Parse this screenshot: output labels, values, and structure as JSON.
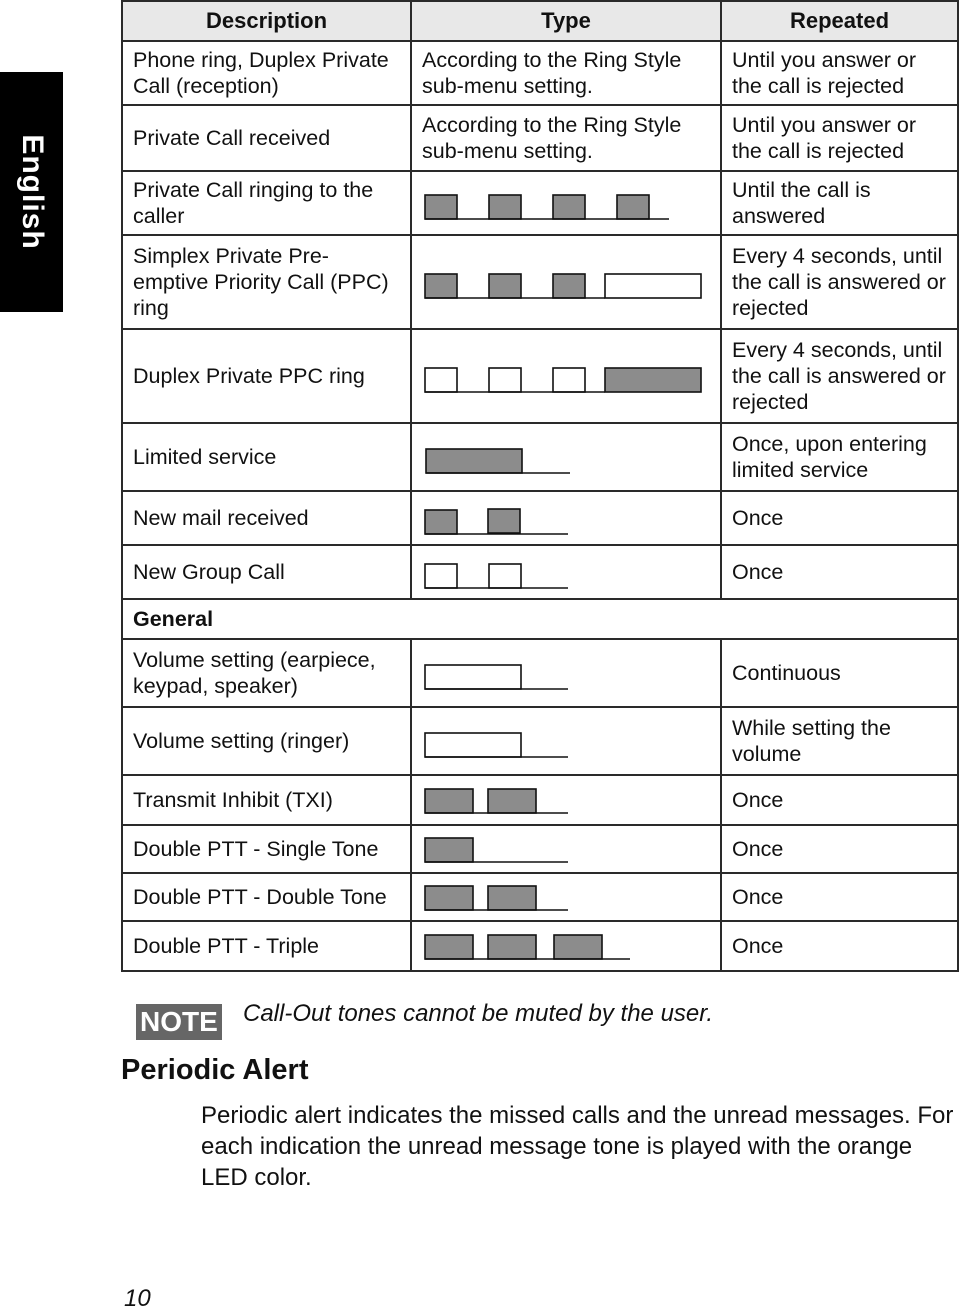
{
  "side_tab": {
    "label": "English"
  },
  "table": {
    "headers": [
      "Description",
      "Type",
      "Repeated"
    ],
    "rows": [
      {
        "description": "Phone ring, Duplex Private Call (reception)",
        "type_text": "According to the Ring Style sub-menu setting.",
        "pattern": null,
        "repeated": "Until you answer or the call is rejected"
      },
      {
        "description": "Private Call received",
        "type_text": "According to the Ring Style sub-menu setting.",
        "pattern": null,
        "repeated": "Until you answer or the call is rejected"
      },
      {
        "description": "Private Call ringing to the caller",
        "type_text": null,
        "pattern": "short-on x4",
        "repeated": "Until the call is answered"
      },
      {
        "description": "Simplex Private Pre-emptive Priority Call (PPC) ring",
        "type_text": null,
        "pattern": "short-on x3, long-off",
        "repeated": "Every 4 seconds, until the call is answered or rejected"
      },
      {
        "description": "Duplex Private PPC ring",
        "type_text": null,
        "pattern": "short-off x3, long-on",
        "repeated": "Every 4 seconds, until the call is answered or rejected"
      },
      {
        "description": "Limited service",
        "type_text": null,
        "pattern": "long-on x1",
        "repeated": "Once, upon entering limited service"
      },
      {
        "description": "New mail received",
        "type_text": null,
        "pattern": "short-on x2",
        "repeated": "Once"
      },
      {
        "description": "New Group Call",
        "type_text": null,
        "pattern": "short-off x2",
        "repeated": "Once"
      }
    ],
    "section_general": "General",
    "general_rows": [
      {
        "description": "Volume setting (earpiece, keypad, speaker)",
        "pattern": "long-off x1",
        "repeated": "Continuous"
      },
      {
        "description": "Volume setting (ringer)",
        "pattern": "long-off x1",
        "repeated": "While setting the volume"
      },
      {
        "description": "Transmit Inhibit (TXI)",
        "pattern": "medium-on x2",
        "repeated": "Once"
      },
      {
        "description": "Double PTT - Single Tone",
        "pattern": "medium-on x1",
        "repeated": "Once"
      },
      {
        "description": "Double PTT - Double Tone",
        "pattern": "medium-on x2",
        "repeated": "Once"
      },
      {
        "description": "Double PTT - Triple",
        "pattern": "medium-on x3",
        "repeated": "Once"
      }
    ]
  },
  "note": {
    "badge": "NOTE",
    "text": "Call-Out tones cannot be muted by the user."
  },
  "periodic_alert": {
    "heading": "Periodic Alert",
    "body": "Periodic alert indicates the missed calls and the unread messages. For each indication the unread message tone is played with the orange LED color."
  },
  "page_number": "10",
  "colors": {
    "tone_on": "#8c8c8c",
    "header_bg": "#e8e8e8",
    "note_badge": "#666666"
  }
}
